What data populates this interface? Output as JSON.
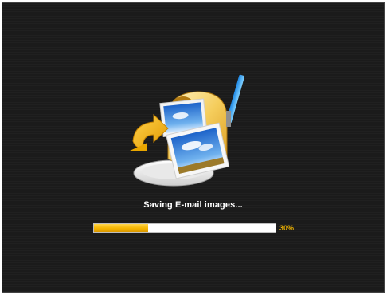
{
  "dialog": {
    "status_text": "Saving E-mail images...",
    "illustration_icon": "mailbox-with-photos-icon"
  },
  "progress": {
    "value": 30,
    "label": "30%"
  },
  "colors": {
    "background": "#1b1b1b",
    "accent": "#f4b400",
    "text": "#ffffff"
  }
}
